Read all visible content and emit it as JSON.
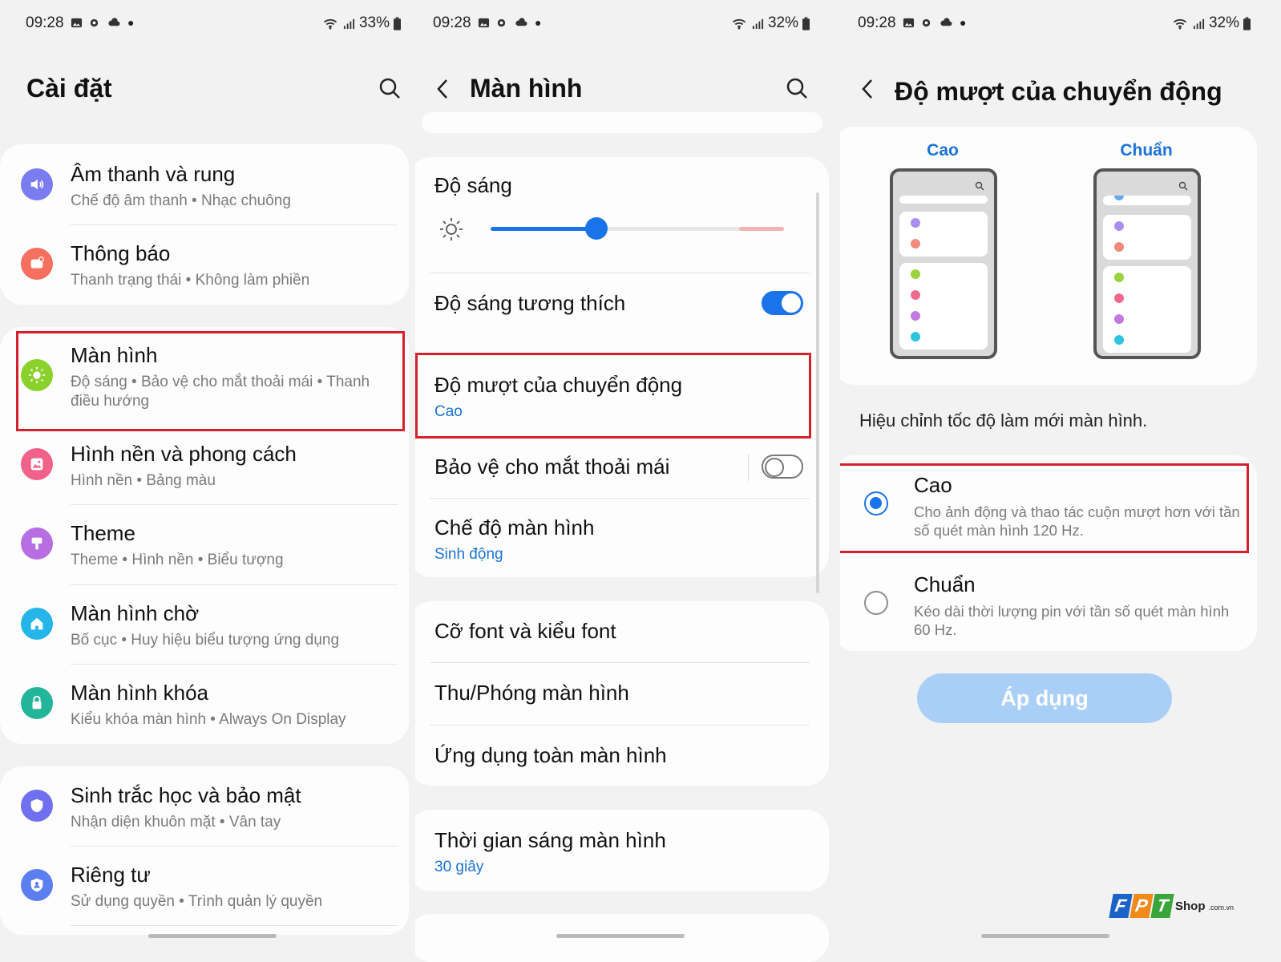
{
  "status_bars": [
    {
      "time": "09:28",
      "battery": "33%"
    },
    {
      "time": "09:28",
      "battery": "32%"
    },
    {
      "time": "09:28",
      "battery": "32%"
    }
  ],
  "panel1": {
    "title": "Cài đặt",
    "items": [
      {
        "label": "Âm thanh và rung",
        "sub": "Chế độ âm thanh  •  Nhạc chuông",
        "icon": "speaker-icon",
        "color": "#7b7cf0"
      },
      {
        "label": "Thông báo",
        "sub": "Thanh trạng thái  •  Không làm phiền",
        "icon": "notification-icon",
        "color": "#f5705e"
      },
      {
        "label": "Màn hình",
        "sub": "Độ sáng  •  Bảo vệ cho mắt thoải mái  •  Thanh điều hướng",
        "icon": "sun-icon",
        "color": "#8bd12b"
      },
      {
        "label": "Hình nền và phong cách",
        "sub": "Hình nền  •  Bảng màu",
        "icon": "image-icon",
        "color": "#f1628a"
      },
      {
        "label": "Theme",
        "sub": "Theme  •  Hình nền  •  Biểu tượng",
        "icon": "brush-icon",
        "color": "#b86ee3"
      },
      {
        "label": "Màn hình chờ",
        "sub": "Bố cục  •  Huy hiệu biểu tượng ứng dụng",
        "icon": "home-icon",
        "color": "#25b5e8"
      },
      {
        "label": "Màn hình khóa",
        "sub": "Kiểu khóa màn hình  •  Always On Display",
        "icon": "lock-icon",
        "color": "#22b59a"
      },
      {
        "label": "Sinh trắc học và bảo mật",
        "sub": "Nhận diện khuôn mặt  •  Vân tay",
        "icon": "shield-icon",
        "color": "#6f6ff0"
      },
      {
        "label": "Riêng tư",
        "sub": "Sử dụng quyền  •  Trình quản lý quyền",
        "icon": "privacy-icon",
        "color": "#5b7ff0"
      }
    ]
  },
  "panel2": {
    "title": "Màn hình",
    "brightness_label": "Độ sáng",
    "brightness_level": 0.36,
    "adaptive_label": "Độ sáng tương thích",
    "adaptive_on": true,
    "motion_label": "Độ mượt của chuyển động",
    "motion_value": "Cao",
    "eye_label": "Bảo vệ cho mắt thoải mái",
    "eye_on": false,
    "mode_label": "Chế độ màn hình",
    "mode_value": "Sinh động",
    "font_label": "Cỡ font và kiểu font",
    "zoom_label": "Thu/Phóng màn hình",
    "fullscreen_label": "Ứng dụng toàn màn hình",
    "timeout_label": "Thời gian sáng màn hình",
    "timeout_value": "30 giây"
  },
  "panel3": {
    "title": "Độ mượt của chuyển động",
    "preview_high": "Cao",
    "preview_std": "Chuẩn",
    "description": "Hiệu chỉnh tốc độ làm mới màn hình.",
    "options": [
      {
        "label": "Cao",
        "desc": "Cho ảnh động và thao tác cuộn mượt hơn với tần số quét màn hình 120 Hz.",
        "selected": true
      },
      {
        "label": "Chuẩn",
        "desc": "Kéo dài thời lượng pin với tần số quét màn hình 60 Hz.",
        "selected": false
      }
    ],
    "apply_label": "Áp dụng"
  },
  "watermark": {
    "brand": "FPT",
    "suffix": "Shop",
    "domain": ".com.vn"
  },
  "colors": {
    "accent": "#1a73e8",
    "highlight": "#d3212d",
    "apply_button": "#aacff6"
  }
}
